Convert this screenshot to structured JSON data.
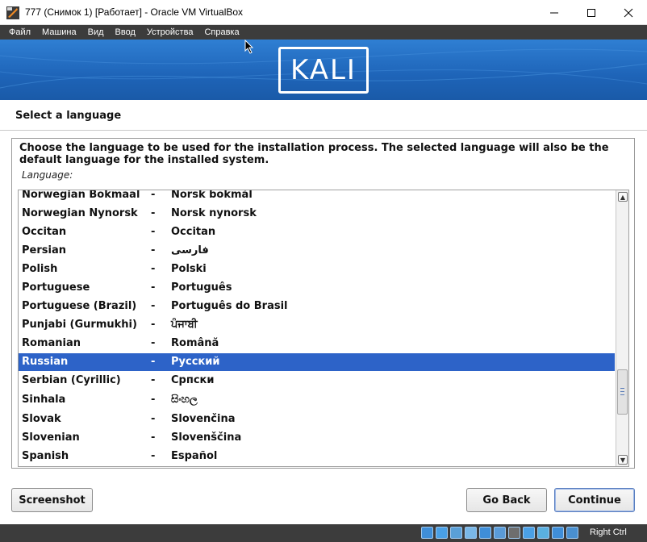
{
  "window": {
    "title": "777 (Снимок 1) [Работает] - Oracle VM VirtualBox"
  },
  "menu": {
    "items": [
      "Файл",
      "Машина",
      "Вид",
      "Ввод",
      "Устройства",
      "Справка"
    ]
  },
  "installer": {
    "logo_text": "KALI",
    "section_title": "Select a language",
    "description": "Choose the language to be used for the installation process. The selected language will also be the default language for the installed system.",
    "language_label": "Language:",
    "languages": [
      {
        "name": "Norwegian Bokmaal",
        "native": "Norsk bokmål"
      },
      {
        "name": "Norwegian Nynorsk",
        "native": "Norsk nynorsk"
      },
      {
        "name": "Occitan",
        "native": "Occitan"
      },
      {
        "name": "Persian",
        "native": "فارسی"
      },
      {
        "name": "Polish",
        "native": "Polski"
      },
      {
        "name": "Portuguese",
        "native": "Português"
      },
      {
        "name": "Portuguese (Brazil)",
        "native": "Português do Brasil"
      },
      {
        "name": "Punjabi (Gurmukhi)",
        "native": "ਪੰਜਾਬੀ"
      },
      {
        "name": "Romanian",
        "native": "Română"
      },
      {
        "name": "Russian",
        "native": "Русский"
      },
      {
        "name": "Serbian (Cyrillic)",
        "native": "Српски"
      },
      {
        "name": "Sinhala",
        "native": "සිංහල"
      },
      {
        "name": "Slovak",
        "native": "Slovenčina"
      },
      {
        "name": "Slovenian",
        "native": "Slovenščina"
      },
      {
        "name": "Spanish",
        "native": "Español"
      }
    ],
    "separator": "-",
    "selected_language": "Russian",
    "buttons": {
      "screenshot": "Screenshot",
      "go_back": "Go Back",
      "continue": "Continue"
    }
  },
  "statusbar": {
    "host_key": "Right Ctrl",
    "icons": [
      "hdd-icon",
      "optical-disc-icon",
      "audio-icon",
      "network-icon",
      "usb-icon",
      "shared-folders-icon",
      "display-icon",
      "video-capture-icon",
      "cpu-icon",
      "mouse-integration-icon",
      "keyboard-icon"
    ]
  },
  "colors": {
    "selection": "#2d63c8",
    "menubar": "#3c3c3c",
    "banner": "#1e64b8"
  }
}
